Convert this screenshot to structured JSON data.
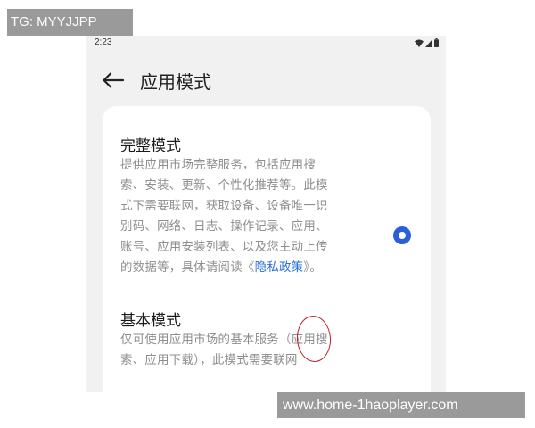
{
  "watermarks": {
    "top_left": "TG: MYYJJPP",
    "bottom_right": "www.home-1haoplayer.com"
  },
  "status_bar": {
    "time": "2:23",
    "icons": [
      "wifi-icon",
      "signal-icon",
      "battery-icon"
    ]
  },
  "header": {
    "back_icon": "arrow-left-icon",
    "title": "应用模式"
  },
  "options": [
    {
      "title": "完整模式",
      "description_lines": [
        "提供应用市场完整服务，包括应用搜",
        "索、安装、更新、个性化推荐等。此模",
        "式下需要联网，获取设备、设备唯一识",
        "别码、网络、日志、操作记录、应用、",
        "账号、应用安装列表、以及您主动上传"
      ],
      "description_last_prefix": "的数据等，具体请阅读《",
      "privacy_link": "隐私政策",
      "description_last_suffix": "》。",
      "selected": true
    },
    {
      "title": "基本模式",
      "description_lines": [
        "仅可使用应用市场的基本服务（应用搜",
        "索、应用下载），此模式需要联网"
      ],
      "selected": false
    }
  ],
  "colors": {
    "accent": "#2a5fd6",
    "link": "#2a6fd6",
    "annotation": "#c4202a"
  }
}
